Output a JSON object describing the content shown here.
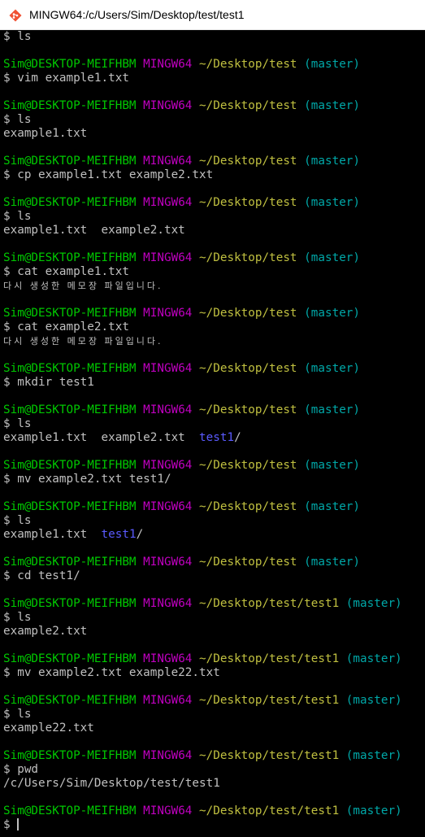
{
  "window": {
    "title": "MINGW64:/c/Users/Sim/Desktop/test/test1",
    "icon": "git-bash-icon"
  },
  "colors": {
    "user": "#00c800",
    "host": "#c000c0",
    "path": "#c0c040",
    "branch": "#00a8a8",
    "directory": "#5a5aff",
    "text": "#c0c0c0",
    "background": "#000000"
  },
  "terminal": {
    "lines": [
      {
        "type": "cmd",
        "text": "$ ls"
      },
      {
        "type": "blank"
      },
      {
        "type": "prompt",
        "user": "Sim@DESKTOP-MEIFHBM",
        "host": "MINGW64",
        "path": "~/Desktop/test",
        "branch": "(master)"
      },
      {
        "type": "cmd",
        "text": "$ vim example1.txt"
      },
      {
        "type": "blank"
      },
      {
        "type": "prompt",
        "user": "Sim@DESKTOP-MEIFHBM",
        "host": "MINGW64",
        "path": "~/Desktop/test",
        "branch": "(master)"
      },
      {
        "type": "cmd",
        "text": "$ ls"
      },
      {
        "type": "out",
        "text": "example1.txt"
      },
      {
        "type": "blank"
      },
      {
        "type": "prompt",
        "user": "Sim@DESKTOP-MEIFHBM",
        "host": "MINGW64",
        "path": "~/Desktop/test",
        "branch": "(master)"
      },
      {
        "type": "cmd",
        "text": "$ cp example1.txt example2.txt"
      },
      {
        "type": "blank"
      },
      {
        "type": "prompt",
        "user": "Sim@DESKTOP-MEIFHBM",
        "host": "MINGW64",
        "path": "~/Desktop/test",
        "branch": "(master)"
      },
      {
        "type": "cmd",
        "text": "$ ls"
      },
      {
        "type": "out",
        "text": "example1.txt  example2.txt"
      },
      {
        "type": "blank"
      },
      {
        "type": "prompt",
        "user": "Sim@DESKTOP-MEIFHBM",
        "host": "MINGW64",
        "path": "~/Desktop/test",
        "branch": "(master)"
      },
      {
        "type": "cmd",
        "text": "$ cat example1.txt"
      },
      {
        "type": "korean",
        "text": "다시 생성한 메모장 파일입니다."
      },
      {
        "type": "blank"
      },
      {
        "type": "prompt",
        "user": "Sim@DESKTOP-MEIFHBM",
        "host": "MINGW64",
        "path": "~/Desktop/test",
        "branch": "(master)"
      },
      {
        "type": "cmd",
        "text": "$ cat example2.txt"
      },
      {
        "type": "korean",
        "text": "다시 생성한 메모장 파일입니다."
      },
      {
        "type": "blank"
      },
      {
        "type": "prompt",
        "user": "Sim@DESKTOP-MEIFHBM",
        "host": "MINGW64",
        "path": "~/Desktop/test",
        "branch": "(master)"
      },
      {
        "type": "cmd",
        "text": "$ mkdir test1"
      },
      {
        "type": "blank"
      },
      {
        "type": "prompt",
        "user": "Sim@DESKTOP-MEIFHBM",
        "host": "MINGW64",
        "path": "~/Desktop/test",
        "branch": "(master)"
      },
      {
        "type": "cmd",
        "text": "$ ls"
      },
      {
        "type": "outdir",
        "text": "example1.txt  example2.txt  ",
        "dir": "test1",
        "suffix": "/"
      },
      {
        "type": "blank"
      },
      {
        "type": "prompt",
        "user": "Sim@DESKTOP-MEIFHBM",
        "host": "MINGW64",
        "path": "~/Desktop/test",
        "branch": "(master)"
      },
      {
        "type": "cmd",
        "text": "$ mv example2.txt test1/"
      },
      {
        "type": "blank"
      },
      {
        "type": "prompt",
        "user": "Sim@DESKTOP-MEIFHBM",
        "host": "MINGW64",
        "path": "~/Desktop/test",
        "branch": "(master)"
      },
      {
        "type": "cmd",
        "text": "$ ls"
      },
      {
        "type": "outdir",
        "text": "example1.txt  ",
        "dir": "test1",
        "suffix": "/"
      },
      {
        "type": "blank"
      },
      {
        "type": "prompt",
        "user": "Sim@DESKTOP-MEIFHBM",
        "host": "MINGW64",
        "path": "~/Desktop/test",
        "branch": "(master)"
      },
      {
        "type": "cmd",
        "text": "$ cd test1/"
      },
      {
        "type": "blank"
      },
      {
        "type": "prompt",
        "user": "Sim@DESKTOP-MEIFHBM",
        "host": "MINGW64",
        "path": "~/Desktop/test/test1",
        "branch": "(master)"
      },
      {
        "type": "cmd",
        "text": "$ ls"
      },
      {
        "type": "out",
        "text": "example2.txt"
      },
      {
        "type": "blank"
      },
      {
        "type": "prompt",
        "user": "Sim@DESKTOP-MEIFHBM",
        "host": "MINGW64",
        "path": "~/Desktop/test/test1",
        "branch": "(master)"
      },
      {
        "type": "cmd",
        "text": "$ mv example2.txt example22.txt"
      },
      {
        "type": "blank"
      },
      {
        "type": "prompt",
        "user": "Sim@DESKTOP-MEIFHBM",
        "host": "MINGW64",
        "path": "~/Desktop/test/test1",
        "branch": "(master)"
      },
      {
        "type": "cmd",
        "text": "$ ls"
      },
      {
        "type": "out",
        "text": "example22.txt"
      },
      {
        "type": "blank"
      },
      {
        "type": "prompt",
        "user": "Sim@DESKTOP-MEIFHBM",
        "host": "MINGW64",
        "path": "~/Desktop/test/test1",
        "branch": "(master)"
      },
      {
        "type": "cmd",
        "text": "$ pwd"
      },
      {
        "type": "out",
        "text": "/c/Users/Sim/Desktop/test/test1"
      },
      {
        "type": "blank"
      },
      {
        "type": "prompt",
        "user": "Sim@DESKTOP-MEIFHBM",
        "host": "MINGW64",
        "path": "~/Desktop/test/test1",
        "branch": "(master)"
      },
      {
        "type": "input",
        "text": "$ "
      }
    ]
  }
}
